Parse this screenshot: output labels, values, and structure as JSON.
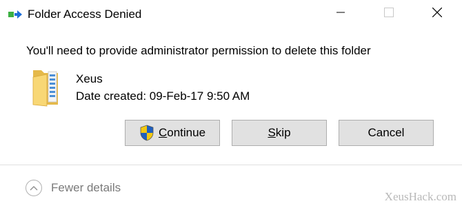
{
  "window": {
    "title": "Folder Access Denied",
    "minimize_icon": "minimize-icon",
    "maximize_icon": "maximize-icon",
    "close_icon": "close-icon"
  },
  "dialog": {
    "message": "You'll need to provide administrator permission to delete this folder",
    "item": {
      "icon": "folder-icon",
      "name": "Xeus",
      "date_created": "Date created: 09-Feb-17 9:50 AM"
    },
    "buttons": {
      "continue": {
        "prefix": "",
        "mnemonic": "C",
        "rest": "ontinue",
        "icon": "uac-shield-icon"
      },
      "skip": {
        "prefix": "",
        "mnemonic": "S",
        "rest": "kip"
      },
      "cancel": {
        "label": "Cancel"
      }
    },
    "details_toggle": {
      "label": "Fewer details",
      "icon": "chevron-up-icon"
    }
  },
  "watermark": "XeusHack.com",
  "colors": {
    "button_bg": "#e1e1e1",
    "button_border": "#adadad",
    "muted_text": "#7a7a7a",
    "watermark": "#b9b9b9"
  }
}
